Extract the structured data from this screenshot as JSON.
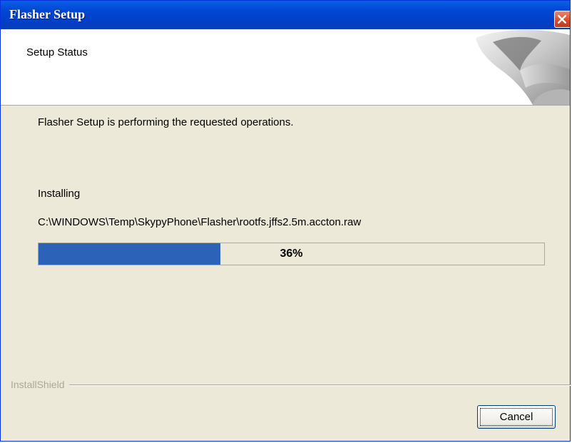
{
  "window": {
    "title": "Flasher Setup"
  },
  "header": {
    "title": "Setup Status"
  },
  "main": {
    "status_text": "Flasher Setup is performing the requested operations.",
    "action_label": "Installing",
    "file_path": "C:\\WINDOWS\\Temp\\SkypyPhone\\Flasher\\rootfs.jffs2.5m.accton.raw",
    "progress_percent": 36,
    "progress_label": "36%"
  },
  "footer": {
    "brand": "InstallShield",
    "cancel_label": "Cancel"
  },
  "icons": {
    "close": "close-icon",
    "header_graphic": "installer-graphic-icon"
  },
  "colors": {
    "titlebar": "#0047d4",
    "progress_fill": "#2c63b8",
    "background": "#ece9d8",
    "close_button": "#d8482b"
  }
}
